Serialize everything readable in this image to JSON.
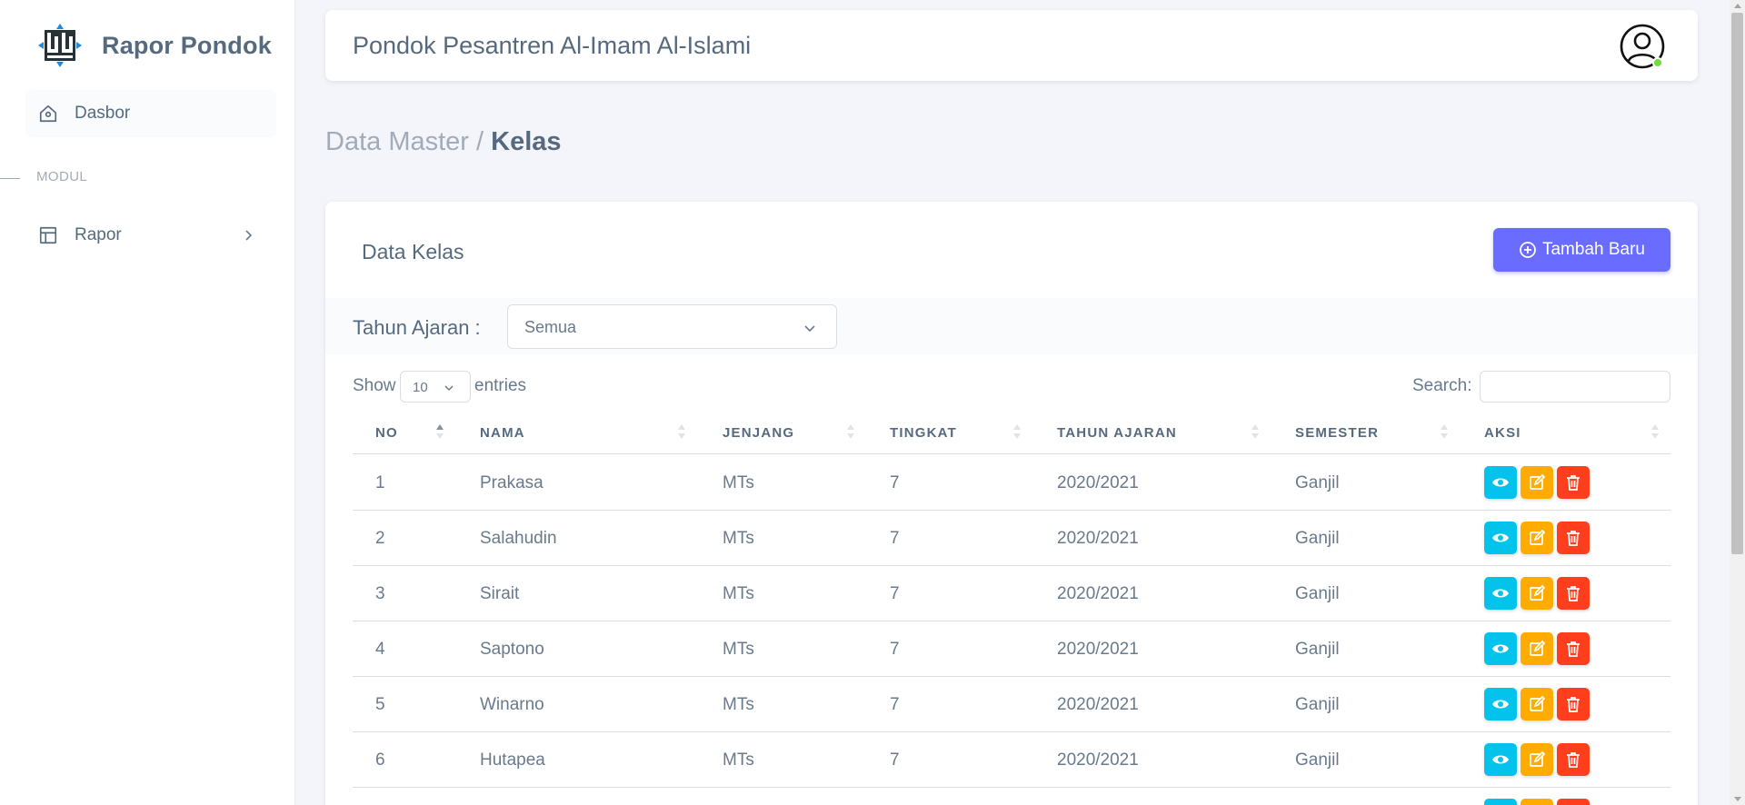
{
  "sidebar": {
    "brand": "Rapor Pondok",
    "items": [
      {
        "label": "Dasbor",
        "icon": "home-icon"
      },
      {
        "label": "Rapor",
        "icon": "layout-icon"
      }
    ],
    "section_header": "MODUL"
  },
  "navbar": {
    "title": "Pondok Pesantren Al-Imam Al-Islami",
    "status_color": "#71dd37"
  },
  "breadcrumb": {
    "parent": "Data Master /",
    "current": "Kelas"
  },
  "card": {
    "title": "Data Kelas",
    "add_button": "Tambah Baru",
    "filter_label": "Tahun Ajaran :",
    "filter_value": "Semua",
    "show_label": "Show",
    "length_value": "10",
    "entries_label": "entries",
    "search_label": "Search:"
  },
  "table": {
    "columns": [
      "NO",
      "NAMA",
      "JENJANG",
      "TINGKAT",
      "TAHUN AJARAN",
      "SEMESTER",
      "AKSI"
    ],
    "rows": [
      {
        "no": "1",
        "nama": "Prakasa",
        "jenjang": "MTs",
        "tingkat": "7",
        "tahun": "2020/2021",
        "semester": "Ganjil"
      },
      {
        "no": "2",
        "nama": "Salahudin",
        "jenjang": "MTs",
        "tingkat": "7",
        "tahun": "2020/2021",
        "semester": "Ganjil"
      },
      {
        "no": "3",
        "nama": "Sirait",
        "jenjang": "MTs",
        "tingkat": "7",
        "tahun": "2020/2021",
        "semester": "Ganjil"
      },
      {
        "no": "4",
        "nama": "Saptono",
        "jenjang": "MTs",
        "tingkat": "7",
        "tahun": "2020/2021",
        "semester": "Ganjil"
      },
      {
        "no": "5",
        "nama": "Winarno",
        "jenjang": "MTs",
        "tingkat": "7",
        "tahun": "2020/2021",
        "semester": "Ganjil"
      },
      {
        "no": "6",
        "nama": "Hutapea",
        "jenjang": "MTs",
        "tingkat": "7",
        "tahun": "2020/2021",
        "semester": "Ganjil"
      },
      {
        "no": "",
        "nama": "",
        "jenjang": "",
        "tingkat": "",
        "tahun": "",
        "semester": ""
      }
    ]
  },
  "colors": {
    "primary": "#696cff",
    "info": "#03c3ec",
    "warning": "#ffab00",
    "danger": "#ff3e1d"
  }
}
